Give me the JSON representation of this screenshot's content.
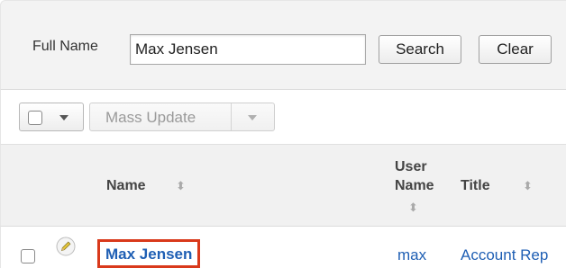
{
  "search": {
    "full_name_label": "Full Name",
    "full_name_value": "Max Jensen",
    "search_button": "Search",
    "clear_button": "Clear"
  },
  "toolbar": {
    "mass_update_label": "Mass Update"
  },
  "table": {
    "columns": {
      "name": "Name",
      "user_name_line1": "User",
      "user_name_line2": "Name",
      "title": "Title"
    },
    "rows": [
      {
        "name": "Max Jensen",
        "user_name": "max",
        "title": "Account Rep"
      }
    ]
  },
  "icons": {
    "sort": "sort-icon",
    "edit": "pencil-icon",
    "dropdown": "chevron-down-icon"
  },
  "colors": {
    "link": "#1f5fb4",
    "highlight_box": "#d9391b"
  }
}
